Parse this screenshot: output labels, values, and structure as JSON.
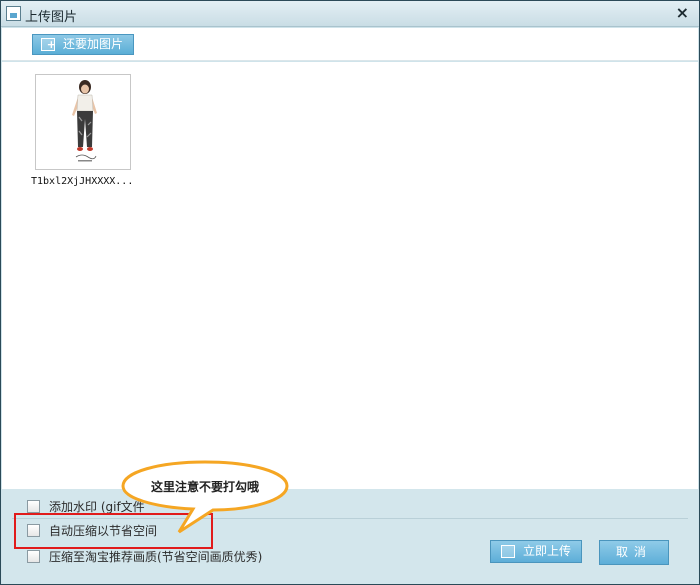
{
  "window": {
    "title": "上传图片",
    "close_label": "×"
  },
  "toolbar": {
    "add_label": "还要加图片"
  },
  "thumbnails": [
    {
      "filename": "T1bxl2XjJHXXXX..."
    }
  ],
  "options": {
    "watermark": "添加水印 (gif文件",
    "compress": "自动压缩以节省空间",
    "taobao": "压缩至淘宝推荐画质(节省空间画质优秀)"
  },
  "buttons": {
    "upload_label": "立即上传",
    "cancel_label": "取消"
  },
  "callout": {
    "text": "这里注意不要打勾哦"
  },
  "colors": {
    "accent": "#5aaed6",
    "highlight": "#e11b1b",
    "callout_border": "#f5a623"
  }
}
